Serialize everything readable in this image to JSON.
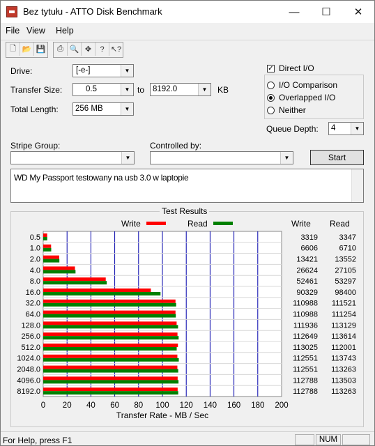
{
  "window": {
    "title": "Bez tytułu - ATTO Disk Benchmark",
    "minimize": "—",
    "maximize": "☐",
    "close": "✕"
  },
  "menu": {
    "file": "File",
    "view": "View",
    "help": "Help"
  },
  "toolbar": [
    "new-icon",
    "open-icon",
    "save-icon",
    "print-icon",
    "print-preview-icon",
    "move-icon",
    "help-icon",
    "context-help-icon"
  ],
  "form": {
    "drive_label": "Drive:",
    "drive_value": "[-e-]",
    "transfer_size_label": "Transfer Size:",
    "transfer_from": "0.5",
    "to_label": "to",
    "transfer_to": "8192.0",
    "unit": "KB",
    "total_length_label": "Total Length:",
    "total_length_value": "256 MB",
    "direct_io_label": "Direct I/O",
    "direct_io_checked": true,
    "io_comparison_label": "I/O Comparison",
    "overlapped_io_label": "Overlapped I/O",
    "neither_label": "Neither",
    "queue_depth_label": "Queue Depth:",
    "queue_depth_value": "4",
    "stripe_group_label": "Stripe Group:",
    "controlled_by_label": "Controlled by:",
    "start_label": "Start",
    "notes": "WD My Passport testowany na usb 3.0 w laptopie"
  },
  "status_bar": {
    "text": "For Help, press F1",
    "num": "NUM"
  },
  "chart_data": {
    "type": "bar",
    "title": "Test Results",
    "xlabel": "Transfer Rate - MB / Sec",
    "xlim": [
      0,
      200
    ],
    "xticks": [
      "0",
      "20",
      "40",
      "60",
      "80",
      "100",
      "120",
      "140",
      "160",
      "180",
      "200"
    ],
    "col_write": "Write",
    "col_read": "Read",
    "colors": {
      "write": "#ff0000",
      "read": "#008000",
      "grid": "#0000aa"
    },
    "categories": [
      "0.5",
      "1.0",
      "2.0",
      "4.0",
      "8.0",
      "16.0",
      "32.0",
      "64.0",
      "128.0",
      "256.0",
      "512.0",
      "1024.0",
      "2048.0",
      "4096.0",
      "8192.0"
    ],
    "series": [
      {
        "name": "Write",
        "values": [
          3319,
          6606,
          13421,
          26624,
          52461,
          90329,
          110988,
          110988,
          111936,
          112649,
          113025,
          112551,
          112551,
          112788,
          112788
        ]
      },
      {
        "name": "Read",
        "values": [
          3347,
          6710,
          13552,
          27105,
          53297,
          98400,
          111521,
          111254,
          113129,
          113614,
          112001,
          113743,
          113263,
          113503,
          113263
        ]
      }
    ]
  }
}
